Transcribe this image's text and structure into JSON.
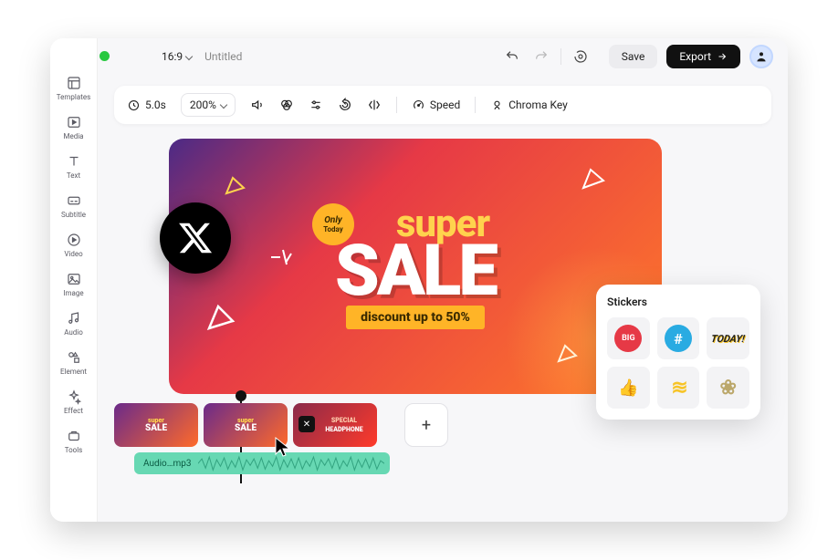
{
  "header": {
    "ratio": "16:9",
    "title": "Untitled",
    "save": "Save",
    "export": "Export"
  },
  "toolbar": {
    "duration": "5.0s",
    "zoom": "200%",
    "speed": "Speed",
    "chroma": "Chroma Key"
  },
  "sidebar": {
    "items": [
      {
        "label": "Templates"
      },
      {
        "label": "Media"
      },
      {
        "label": "Text"
      },
      {
        "label": "Subtitle"
      },
      {
        "label": "Video"
      },
      {
        "label": "Image"
      },
      {
        "label": "Audio"
      },
      {
        "label": "Element"
      },
      {
        "label": "Effect"
      },
      {
        "label": "Tools"
      }
    ]
  },
  "canvas": {
    "only": "Only",
    "today": "Today",
    "super": "super",
    "sale": "SALE",
    "discount": "discount up to 50%"
  },
  "stickers": {
    "title": "Stickers",
    "items": [
      {
        "label": "BIG",
        "color": "#e63946",
        "fg": "#fff"
      },
      {
        "label": "#",
        "color": "#29abe2",
        "fg": "#fff"
      },
      {
        "label": "TODAY!",
        "color": "transparent",
        "fg": "#222"
      },
      {
        "label": "👍",
        "color": "#fff",
        "fg": "#296ae2"
      },
      {
        "label": "≋",
        "color": "transparent",
        "fg": "#f7c427"
      },
      {
        "label": "❀",
        "color": "transparent",
        "fg": "#bba76a"
      }
    ]
  },
  "timeline": {
    "audio_label": "Audio…mp3",
    "clip3_badge": "✕",
    "clip3_text": "SPECIAL",
    "clip3_sub": "HEADPHONE"
  }
}
